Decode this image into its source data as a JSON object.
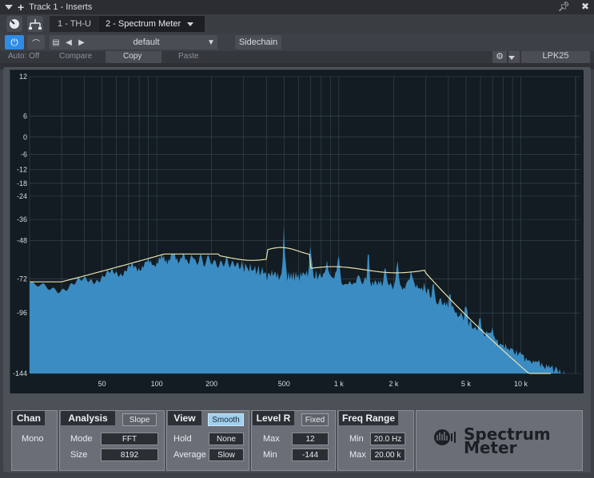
{
  "titlebar": {
    "title": "Track 1 - Inserts",
    "pin_icon": "pin-icon",
    "close_icon": "close-icon"
  },
  "inserts": {
    "slot1": "1 - TH-U",
    "slot2": "2 - Spectrum Meter"
  },
  "preset": {
    "name": "default",
    "sidechain": "Sidechain"
  },
  "autorow": {
    "auto": "Auto: Off",
    "compare": "Compare",
    "copy": "Copy",
    "paste": "Paste",
    "device": "LPK25"
  },
  "graph": {
    "y_ticks": [
      "12",
      "6",
      "0",
      "-6",
      "-12",
      "-18",
      "-24",
      "-36",
      "-48",
      "-72",
      "-96",
      "-144"
    ],
    "x_ticks": [
      "50",
      "100",
      "200",
      "500",
      "1 k",
      "2 k",
      "5 k",
      "10 k"
    ],
    "colors": {
      "bg": "#121c22",
      "fill": "#3b8cc2",
      "curve": "#e6e0b0",
      "grid": "#3b4a52"
    }
  },
  "panel": {
    "chan": {
      "title": "Chan",
      "value": "Mono"
    },
    "analysis": {
      "title": "Analysis",
      "toggle": "Slope",
      "mode_label": "Mode",
      "mode": "FFT",
      "size_label": "Size",
      "size": "8192"
    },
    "view": {
      "title": "View",
      "toggle": "Smooth",
      "hold_label": "Hold",
      "hold": "None",
      "avg_label": "Average",
      "avg": "Slow"
    },
    "level": {
      "title": "Level R",
      "toggle": "Fixed",
      "max_label": "Max",
      "max": "12",
      "min_label": "Min",
      "min": "-144"
    },
    "freq": {
      "title": "Freq Range",
      "min_label": "Min",
      "min": "20.0 Hz",
      "max_label": "Max",
      "max": "20.00 k"
    }
  },
  "brand": {
    "line1": "Spectrum",
    "line2": "Meter"
  }
}
